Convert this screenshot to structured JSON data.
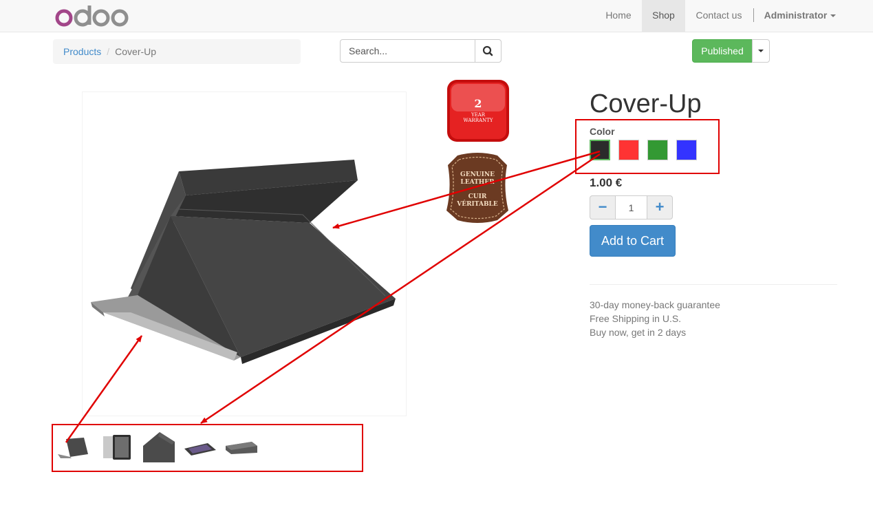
{
  "brand": {
    "logo_text": "odoo"
  },
  "nav": {
    "items": [
      {
        "label": "Home"
      },
      {
        "label": "Shop"
      },
      {
        "label": "Contact us"
      }
    ],
    "user": "Administrator"
  },
  "breadcrumb": {
    "parent": "Products",
    "separator": "/",
    "current": "Cover-Up"
  },
  "search": {
    "placeholder": "Search..."
  },
  "publish": {
    "label": "Published",
    "color": "#5cb85c"
  },
  "product": {
    "name": "Cover-Up",
    "color_label": "Color",
    "colors": [
      {
        "name": "black",
        "hex": "#2b2b2b",
        "selected": true
      },
      {
        "name": "red",
        "hex": "#ff3333",
        "selected": false
      },
      {
        "name": "green",
        "hex": "#339933",
        "selected": false
      },
      {
        "name": "blue",
        "hex": "#3333ff",
        "selected": false
      }
    ],
    "price": "1.00 €",
    "quantity": "1",
    "minus_symbol": "−",
    "plus_symbol": "+",
    "add_to_cart": "Add to Cart",
    "benefits": [
      "30-day money-back guarantee",
      "Free Shipping in U.S.",
      "Buy now, get in 2 days"
    ]
  },
  "badges": {
    "warranty": {
      "number": "2",
      "line1": "YEAR",
      "line2": "WARRANTY"
    },
    "leather": {
      "line1": "GENUINE",
      "line2": "LEATHER",
      "line3": "CUIR",
      "line4": "VÉRITABLE"
    }
  },
  "thumbnails": [
    "tablet-stand-thumb",
    "tablet-front-thumb",
    "cover-closed-thumb",
    "tablet-flat-thumb",
    "cover-side-thumb"
  ],
  "annotation_color": "#e00000"
}
